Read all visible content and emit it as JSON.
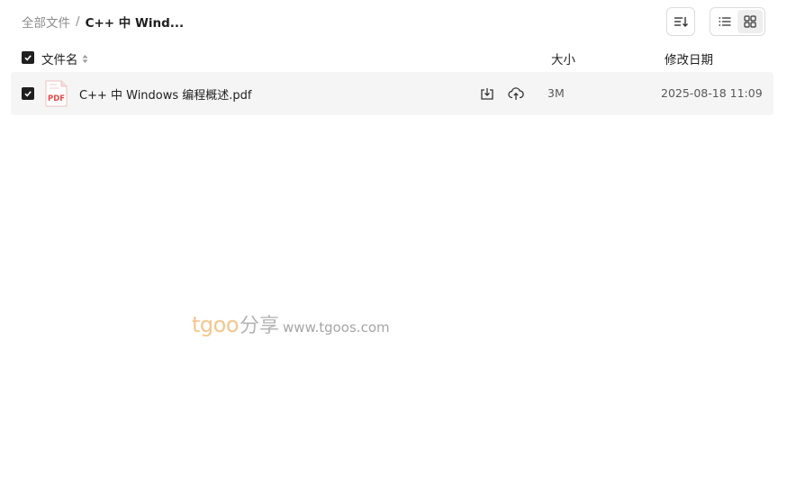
{
  "breadcrumb": {
    "root": "全部文件",
    "separator": "/",
    "current": "C++ 中 Wind..."
  },
  "toolbar": {
    "sort_icon": "sort-icon",
    "view_list_icon": "list-view-icon",
    "view_grid_icon": "grid-view-icon",
    "active_view": "list"
  },
  "table": {
    "headers": {
      "name": "文件名",
      "size": "大小",
      "date": "修改日期"
    },
    "rows": [
      {
        "name": "C++ 中 Windows 编程概述.pdf",
        "size": "3M",
        "date": "2025-08-18 11:09",
        "type_icon": "pdf-file-icon",
        "type_label": "PDF",
        "checked": true
      }
    ]
  },
  "watermark": {
    "brand_latin": "tgoo",
    "brand_cn": "分享",
    "url": "www.tgoos.com"
  },
  "colors": {
    "row_background": "#f5f5f5",
    "checkbox": "#1f1f1f",
    "pdf_red": "#e24b4b",
    "muted_text": "#8c8c8c"
  }
}
